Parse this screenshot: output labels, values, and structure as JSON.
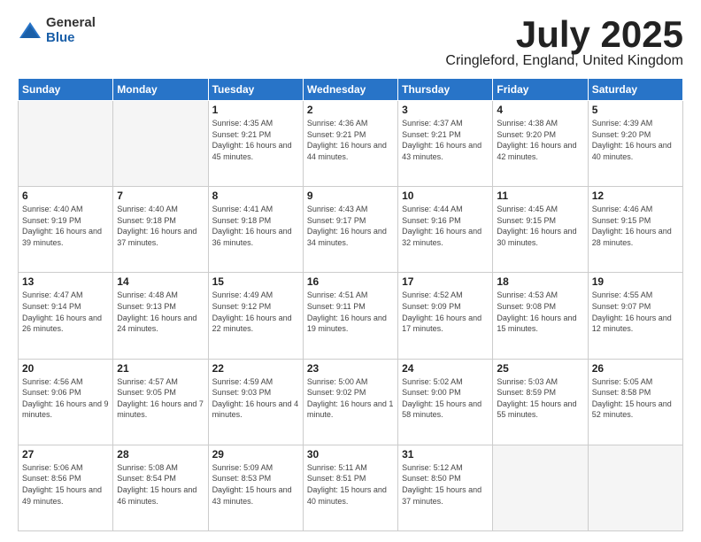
{
  "logo": {
    "general": "General",
    "blue": "Blue"
  },
  "title": "July 2025",
  "location": "Cringleford, England, United Kingdom",
  "days_of_week": [
    "Sunday",
    "Monday",
    "Tuesday",
    "Wednesday",
    "Thursday",
    "Friday",
    "Saturday"
  ],
  "weeks": [
    [
      {
        "day": "",
        "info": ""
      },
      {
        "day": "",
        "info": ""
      },
      {
        "day": "1",
        "info": "Sunrise: 4:35 AM\nSunset: 9:21 PM\nDaylight: 16 hours and 45 minutes."
      },
      {
        "day": "2",
        "info": "Sunrise: 4:36 AM\nSunset: 9:21 PM\nDaylight: 16 hours and 44 minutes."
      },
      {
        "day": "3",
        "info": "Sunrise: 4:37 AM\nSunset: 9:21 PM\nDaylight: 16 hours and 43 minutes."
      },
      {
        "day": "4",
        "info": "Sunrise: 4:38 AM\nSunset: 9:20 PM\nDaylight: 16 hours and 42 minutes."
      },
      {
        "day": "5",
        "info": "Sunrise: 4:39 AM\nSunset: 9:20 PM\nDaylight: 16 hours and 40 minutes."
      }
    ],
    [
      {
        "day": "6",
        "info": "Sunrise: 4:40 AM\nSunset: 9:19 PM\nDaylight: 16 hours and 39 minutes."
      },
      {
        "day": "7",
        "info": "Sunrise: 4:40 AM\nSunset: 9:18 PM\nDaylight: 16 hours and 37 minutes."
      },
      {
        "day": "8",
        "info": "Sunrise: 4:41 AM\nSunset: 9:18 PM\nDaylight: 16 hours and 36 minutes."
      },
      {
        "day": "9",
        "info": "Sunrise: 4:43 AM\nSunset: 9:17 PM\nDaylight: 16 hours and 34 minutes."
      },
      {
        "day": "10",
        "info": "Sunrise: 4:44 AM\nSunset: 9:16 PM\nDaylight: 16 hours and 32 minutes."
      },
      {
        "day": "11",
        "info": "Sunrise: 4:45 AM\nSunset: 9:15 PM\nDaylight: 16 hours and 30 minutes."
      },
      {
        "day": "12",
        "info": "Sunrise: 4:46 AM\nSunset: 9:15 PM\nDaylight: 16 hours and 28 minutes."
      }
    ],
    [
      {
        "day": "13",
        "info": "Sunrise: 4:47 AM\nSunset: 9:14 PM\nDaylight: 16 hours and 26 minutes."
      },
      {
        "day": "14",
        "info": "Sunrise: 4:48 AM\nSunset: 9:13 PM\nDaylight: 16 hours and 24 minutes."
      },
      {
        "day": "15",
        "info": "Sunrise: 4:49 AM\nSunset: 9:12 PM\nDaylight: 16 hours and 22 minutes."
      },
      {
        "day": "16",
        "info": "Sunrise: 4:51 AM\nSunset: 9:11 PM\nDaylight: 16 hours and 19 minutes."
      },
      {
        "day": "17",
        "info": "Sunrise: 4:52 AM\nSunset: 9:09 PM\nDaylight: 16 hours and 17 minutes."
      },
      {
        "day": "18",
        "info": "Sunrise: 4:53 AM\nSunset: 9:08 PM\nDaylight: 16 hours and 15 minutes."
      },
      {
        "day": "19",
        "info": "Sunrise: 4:55 AM\nSunset: 9:07 PM\nDaylight: 16 hours and 12 minutes."
      }
    ],
    [
      {
        "day": "20",
        "info": "Sunrise: 4:56 AM\nSunset: 9:06 PM\nDaylight: 16 hours and 9 minutes."
      },
      {
        "day": "21",
        "info": "Sunrise: 4:57 AM\nSunset: 9:05 PM\nDaylight: 16 hours and 7 minutes."
      },
      {
        "day": "22",
        "info": "Sunrise: 4:59 AM\nSunset: 9:03 PM\nDaylight: 16 hours and 4 minutes."
      },
      {
        "day": "23",
        "info": "Sunrise: 5:00 AM\nSunset: 9:02 PM\nDaylight: 16 hours and 1 minute."
      },
      {
        "day": "24",
        "info": "Sunrise: 5:02 AM\nSunset: 9:00 PM\nDaylight: 15 hours and 58 minutes."
      },
      {
        "day": "25",
        "info": "Sunrise: 5:03 AM\nSunset: 8:59 PM\nDaylight: 15 hours and 55 minutes."
      },
      {
        "day": "26",
        "info": "Sunrise: 5:05 AM\nSunset: 8:58 PM\nDaylight: 15 hours and 52 minutes."
      }
    ],
    [
      {
        "day": "27",
        "info": "Sunrise: 5:06 AM\nSunset: 8:56 PM\nDaylight: 15 hours and 49 minutes."
      },
      {
        "day": "28",
        "info": "Sunrise: 5:08 AM\nSunset: 8:54 PM\nDaylight: 15 hours and 46 minutes."
      },
      {
        "day": "29",
        "info": "Sunrise: 5:09 AM\nSunset: 8:53 PM\nDaylight: 15 hours and 43 minutes."
      },
      {
        "day": "30",
        "info": "Sunrise: 5:11 AM\nSunset: 8:51 PM\nDaylight: 15 hours and 40 minutes."
      },
      {
        "day": "31",
        "info": "Sunrise: 5:12 AM\nSunset: 8:50 PM\nDaylight: 15 hours and 37 minutes."
      },
      {
        "day": "",
        "info": ""
      },
      {
        "day": "",
        "info": ""
      }
    ]
  ]
}
